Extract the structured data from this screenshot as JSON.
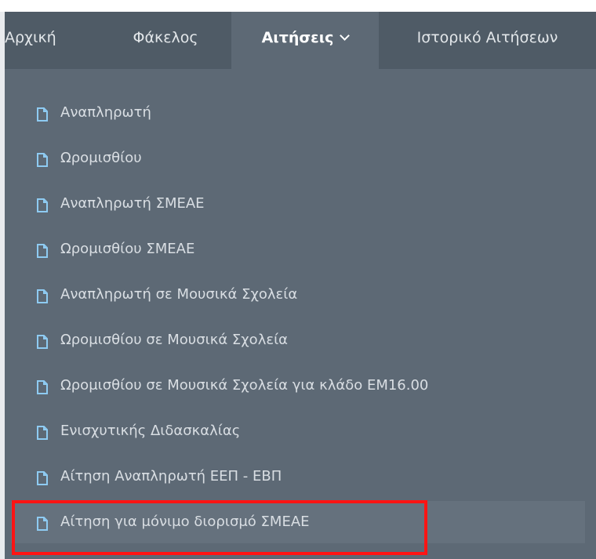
{
  "navbar": {
    "items": [
      {
        "label": "Αρχική"
      },
      {
        "label": "Φάκελος"
      },
      {
        "label": "Αιτήσεις"
      },
      {
        "label": "Ιστορικό Αιτήσεων"
      }
    ],
    "active_item": "Αιτήσεις",
    "dropdown_chevron_icon": "chevron-down-icon"
  },
  "dropdown": {
    "item_icon": "document-icon",
    "items": [
      {
        "label": "Αναπληρωτή"
      },
      {
        "label": "Ωρομισθίου"
      },
      {
        "label": "Αναπληρωτή ΣΜΕΑΕ"
      },
      {
        "label": "Ωρομισθίου ΣΜΕΑΕ"
      },
      {
        "label": "Αναπληρωτή σε Μουσικά Σχολεία"
      },
      {
        "label": "Ωρομισθίου σε Μουσικά Σχολεία"
      },
      {
        "label": "Ωρομισθίου σε Μουσικά Σχολεία για κλάδο ΕΜ16.00"
      },
      {
        "label": "Ενισχυτικής Διδασκαλίας"
      },
      {
        "label": "Αίτηση Αναπληρωτή ΕΕΠ - ΕΒΠ"
      },
      {
        "label": "Αίτηση για μόνιμο διορισμό ΣΜΕΑΕ"
      }
    ],
    "highlighted_item": "Αίτηση για μόνιμο διορισμό ΣΜΕΑΕ"
  },
  "colors": {
    "navbar_background": "#4f5b66",
    "menu_background": "#5d6975",
    "hover_background": "#65717d",
    "highlight_border": "#ff1414"
  }
}
